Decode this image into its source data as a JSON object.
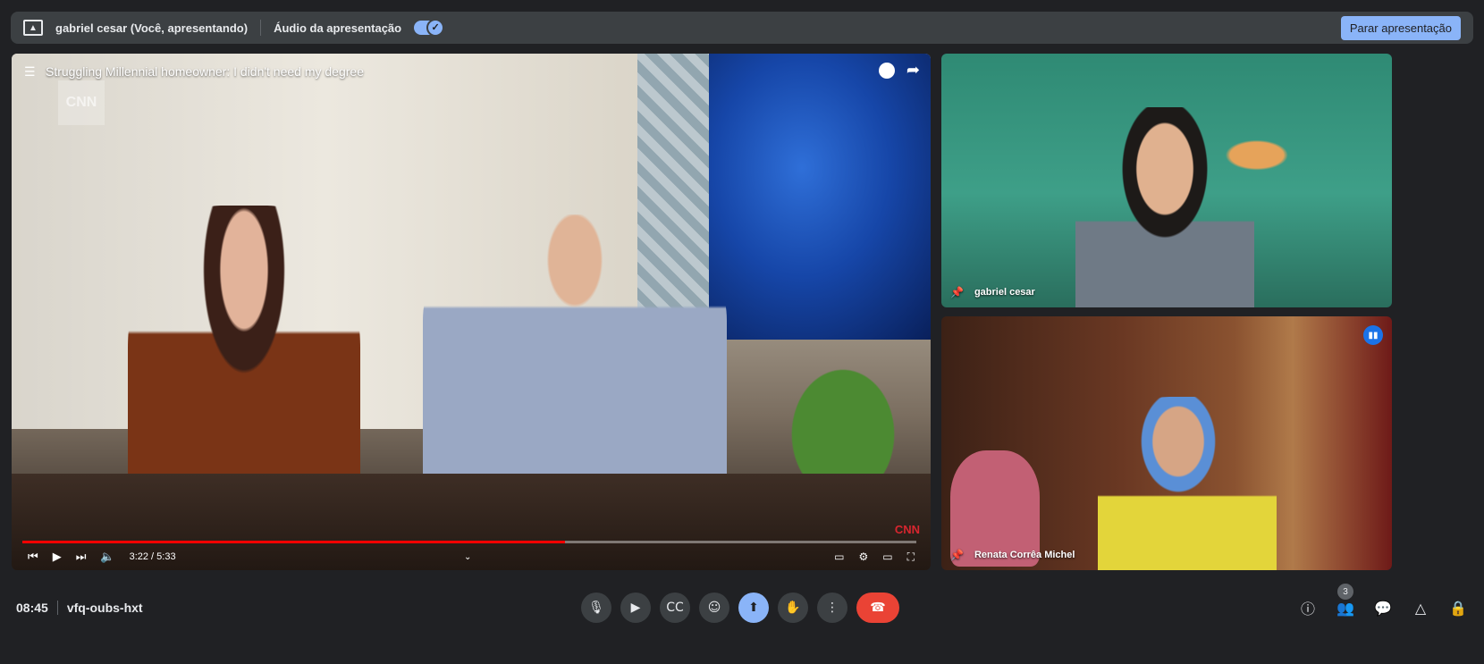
{
  "presenting_bar": {
    "presenter": "gabriel cesar (Você, apresentando)",
    "audio_label": "Áudio da apresentação",
    "audio_enabled": true,
    "stop_label": "Parar apresentação"
  },
  "video": {
    "title": "Struggling Millennial homeowner: I didn't need my degree",
    "watermark": "CNN",
    "logo": "CNN",
    "time": "3:22 / 5:33",
    "progress_fraction": 0.607
  },
  "participants": [
    {
      "name": "gabriel cesar",
      "pinned_icon": "pin-icon"
    },
    {
      "name": "Renata Corrêa Michel",
      "pinned_icon": "pin-icon",
      "speaking": true
    }
  ],
  "meeting": {
    "time": "08:45",
    "code": "vfq-oubs-hxt",
    "people_count": "3"
  },
  "colors": {
    "accent": "#8ab4f8",
    "end_call": "#ea4335",
    "bar_bg": "#3c4043",
    "page_bg": "#202124"
  }
}
